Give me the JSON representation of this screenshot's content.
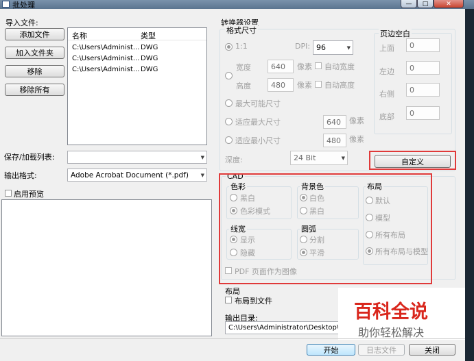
{
  "window": {
    "title": "批处理"
  },
  "import": {
    "label": "导入文件:",
    "add_file": "添加文件",
    "add_folder": "加入文件夹",
    "remove": "移除",
    "remove_all": "移除所有",
    "columns": [
      "名称",
      "类型"
    ],
    "files": [
      {
        "name": "C:\\Users\\Administ...",
        "type": "DWG"
      },
      {
        "name": "C:\\Users\\Administ...",
        "type": "DWG"
      },
      {
        "name": "C:\\Users\\Administ...",
        "type": "DWG"
      }
    ]
  },
  "save_list": {
    "label": "保存/加载列表:",
    "value": ""
  },
  "output_format": {
    "label": "输出格式:",
    "value": "Adobe Acrobat Document (*.pdf)"
  },
  "preview": {
    "label": "启用预览",
    "checked": false
  },
  "converter": {
    "section_title": "转换器设置",
    "format_size": "格式尺寸",
    "ratio_label": "1:1",
    "dpi_label": "DPI:",
    "dpi_value": "96",
    "width_label": "宽度",
    "width_value": "640",
    "height_label": "高度",
    "height_value": "480",
    "pixel_unit": "像素",
    "auto_width": "自动宽度",
    "auto_height": "自动高度",
    "max_size": "最大可能尺寸",
    "fit_max": "适应最大尺寸",
    "fit_max_value": "640",
    "fit_min": "适应最小尺寸",
    "fit_min_value": "480",
    "depth_label": "深度:",
    "depth_value": "24 Bit"
  },
  "margins": {
    "title": "页边空白",
    "top_label": "上面",
    "top_value": "0",
    "left_label": "左边",
    "left_value": "0",
    "right_label": "右侧",
    "right_value": "0",
    "bottom_label": "底部",
    "bottom_value": "0"
  },
  "custom_button": "自定义",
  "cad": {
    "title": "CAD",
    "color_title": "色彩",
    "color_bw": "黑白",
    "color_mode": "色彩模式",
    "bg_title": "背景色",
    "bg_white": "白色",
    "bg_black": "黑白",
    "layout_title": "布局",
    "layout_default": "默认",
    "layout_model": "模型",
    "layout_all": "所有布局",
    "layout_all_model": "所有布局与模型",
    "linewidth_title": "线宽",
    "lw_show": "显示",
    "lw_hide": "隐藏",
    "arc_title": "圆弧",
    "arc_split": "分割",
    "arc_smooth": "平滑",
    "pdf_as_image": "PDF 页面作为图像"
  },
  "layout_section": {
    "title": "布局",
    "layout_to_file": "布局到文件"
  },
  "output_dir": {
    "label": "输出目录:",
    "value": "C:\\Users\\Administrator\\Desktop\\"
  },
  "footer": {
    "start": "开始",
    "log": "日志文件",
    "close": "关闭"
  },
  "watermark": {
    "title": "百科全说",
    "subtitle": "助你轻松解决"
  },
  "colors": {
    "highlight_red": "#e03a3a",
    "watermark_red": "#d9261c",
    "title_bar": "#6b84a0"
  }
}
